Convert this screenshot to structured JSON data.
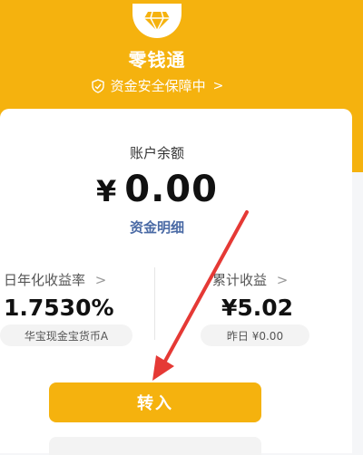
{
  "header": {
    "app_title": "零钱通",
    "security_text": "资金安全保障中",
    "security_chevron": ">"
  },
  "balance": {
    "label": "账户余额",
    "currency": "¥",
    "amount": "0.00",
    "detail_link": "资金明细"
  },
  "stats": {
    "yield_label": "日年化收益率",
    "yield_chevron": ">",
    "yield_value": "1.7530%",
    "fund_name": "华宝现金宝货币A",
    "total_label": "累计收益",
    "total_chevron": ">",
    "total_value": "¥5.02",
    "yesterday": "昨日 ¥0.00"
  },
  "actions": {
    "transfer_in": "转入"
  },
  "colors": {
    "brand": "#f5b20e",
    "link": "#4a6aa5",
    "annotation": "#e53935"
  },
  "icons": {
    "logo": "diamond-icon",
    "security": "shield-icon"
  }
}
